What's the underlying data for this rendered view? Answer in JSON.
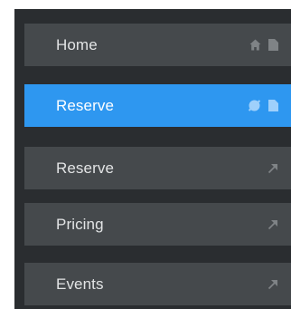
{
  "sidebar": {
    "items": [
      {
        "label": "Home",
        "icons": [
          "home-icon",
          "page-icon"
        ],
        "active": false
      },
      {
        "label": "Reserve",
        "icons": [
          "hidden-icon",
          "page-icon"
        ],
        "active": true
      },
      {
        "label": "Reserve",
        "icons": [
          "external-link-icon"
        ],
        "active": false
      },
      {
        "label": "Pricing",
        "icons": [
          "external-link-icon"
        ],
        "active": false
      },
      {
        "label": "Events",
        "icons": [
          "external-link-icon"
        ],
        "active": false
      }
    ]
  },
  "colors": {
    "panel_bg": "#2a2d30",
    "item_bg": "#45494c",
    "active_bg": "#2e97f0",
    "icon_muted": "#7f8386"
  }
}
